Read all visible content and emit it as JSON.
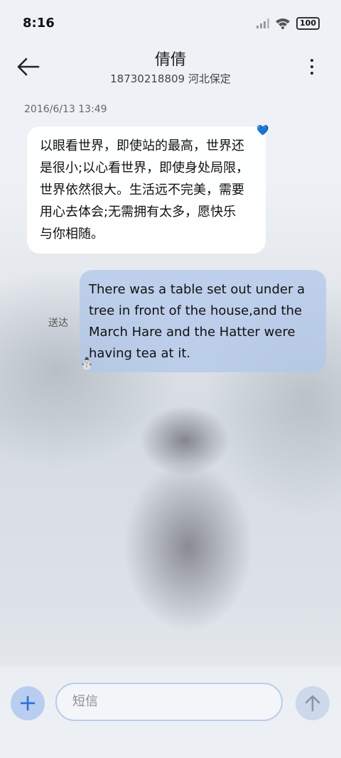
{
  "status_bar": {
    "time": "8:16",
    "battery": "100"
  },
  "header": {
    "title": "倩倩",
    "subtitle": "18730218809 河北保定"
  },
  "conversation": {
    "timestamp": "2016/6/13 13:49",
    "incoming": {
      "lines": [
        "以眼看世界，即使站的最高，世界还",
        "是很小;以心看世界，即使身处局限，",
        "世界依然很大。生活远不完美，需要",
        "用心去体会;无需拥有太多，愿快乐",
        "与你相随。"
      ],
      "reaction": "💙"
    },
    "outgoing": {
      "lines": [
        "There was a table set out under a",
        "tree in front of the house,and the",
        "March Hare and the Hatter were",
        "having tea at it."
      ],
      "status": "送达",
      "sticker": "⛄"
    }
  },
  "composer": {
    "placeholder": "短信",
    "plus": "+",
    "send_icon": "arrow-up-icon"
  },
  "colors": {
    "accent": "#2f6fd8",
    "bubble_out": "#b2c8e9"
  }
}
